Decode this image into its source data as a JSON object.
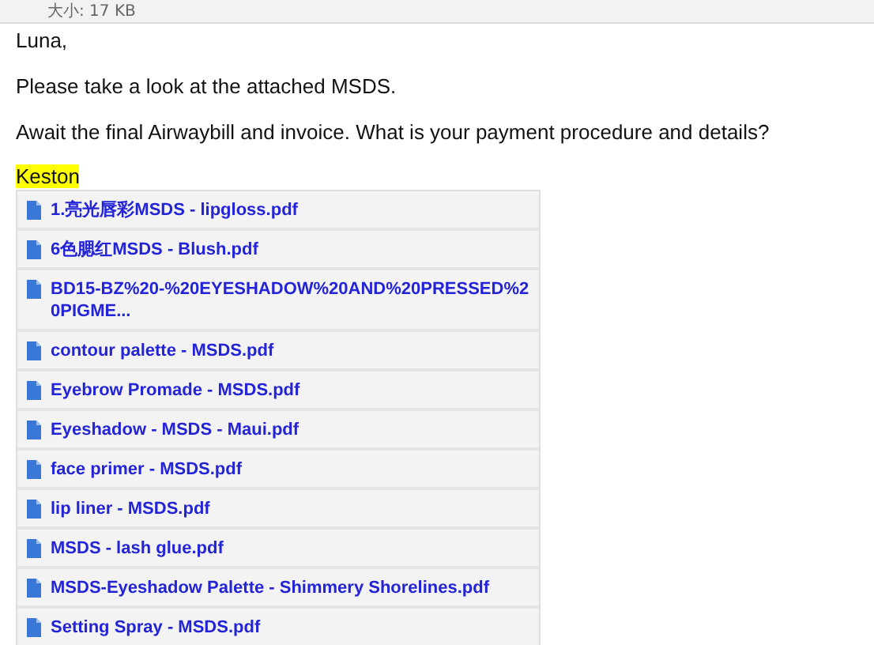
{
  "header": {
    "size_label": "大小: 17 KB"
  },
  "message": {
    "greeting": "Luna,",
    "paragraphs": [
      "Please take a look at the attached MSDS.",
      "Await the final Airwaybill and invoice. What is your payment procedure and details?"
    ],
    "signature": "Keston"
  },
  "attachments": [
    {
      "name": "1.亮光唇彩MSDS - lipgloss.pdf"
    },
    {
      "name": "6色腮红MSDS - Blush.pdf"
    },
    {
      "name": "BD15-BZ%20-%20EYESHADOW%20AND%20PRESSED%20PIGME..."
    },
    {
      "name": "contour palette - MSDS.pdf"
    },
    {
      "name": "Eyebrow Promade - MSDS.pdf"
    },
    {
      "name": "Eyeshadow - MSDS - Maui.pdf"
    },
    {
      "name": "face primer - MSDS.pdf"
    },
    {
      "name": "lip liner - MSDS.pdf"
    },
    {
      "name": "MSDS - lash glue.pdf"
    },
    {
      "name": "MSDS-Eyeshadow Palette - Shimmery Shorelines.pdf"
    },
    {
      "name": "Setting Spray - MSDS.pdf"
    }
  ]
}
